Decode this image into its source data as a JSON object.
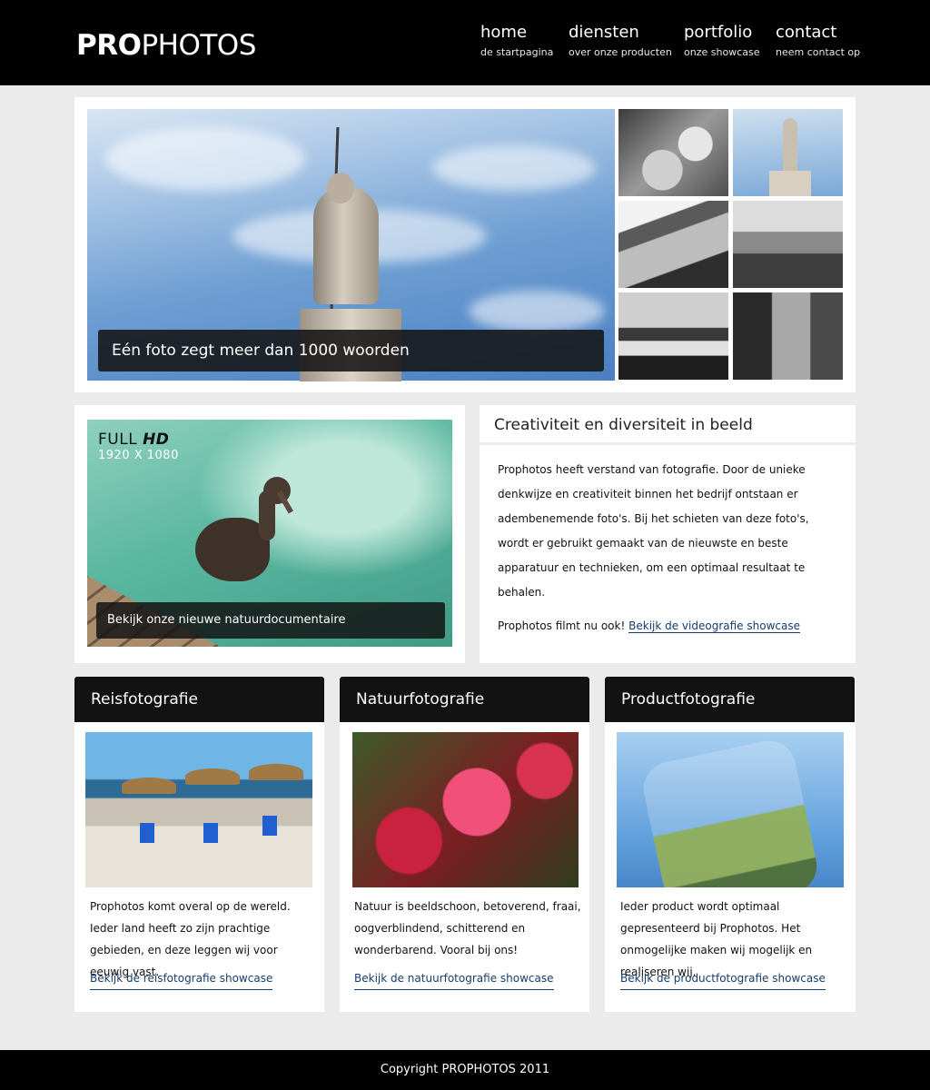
{
  "brand": {
    "bold": "PRO",
    "light": "PHOTOS"
  },
  "nav": [
    {
      "title": "home",
      "sub": "de startpagina"
    },
    {
      "title": "diensten",
      "sub": "over onze producten"
    },
    {
      "title": "portfolio",
      "sub": "onze showcase"
    },
    {
      "title": "contact",
      "sub": "neem contact op"
    }
  ],
  "hero": {
    "caption": "Eén foto zegt meer dan 1000 woorden"
  },
  "video": {
    "label_full": "FULL",
    "label_hd": "HD",
    "resolution": "1920 X 1080",
    "caption": "Bekijk onze nieuwe natuurdocumentaire"
  },
  "info": {
    "title": "Creativiteit en diversiteit in beeld",
    "paragraph": "Prophotos heeft verstand van fotografie. Door de unieke denkwijze en creativiteit binnen het bedrijf ontstaan er adembenemende foto's. Bij het schieten van deze foto's, wordt er gebruikt gemaakt van de nieuwste en beste apparatuur en technieken, om een optimaal resultaat te behalen.",
    "video_prefix": "Prophotos filmt nu ook!",
    "video_link": "Bekijk de videografie showcase"
  },
  "services": [
    {
      "title": "Reisfotografie",
      "text": "Prophotos komt overal op de wereld. Ieder land heeft zo zijn prachtige gebieden, en deze leggen wij voor eeuwig vast.",
      "link": "Bekijk de reisfotografie showcase"
    },
    {
      "title": "Natuurfotografie",
      "text": "Natuur is beeldschoon, betoverend, fraai, oogverblindend, schitterend en wonderbarend. Vooral bij ons!",
      "link": "Bekijk de natuurfotografie showcase"
    },
    {
      "title": "Productfotografie",
      "text": "Ieder product wordt optimaal gepresenteerd bij Prophotos. Het onmogelijke maken wij mogelijk en realiseren wij.",
      "link": "Bekijk de productfotografie showcase"
    }
  ],
  "footer": {
    "copyright": "Copyright PROPHOTOS 2011"
  }
}
